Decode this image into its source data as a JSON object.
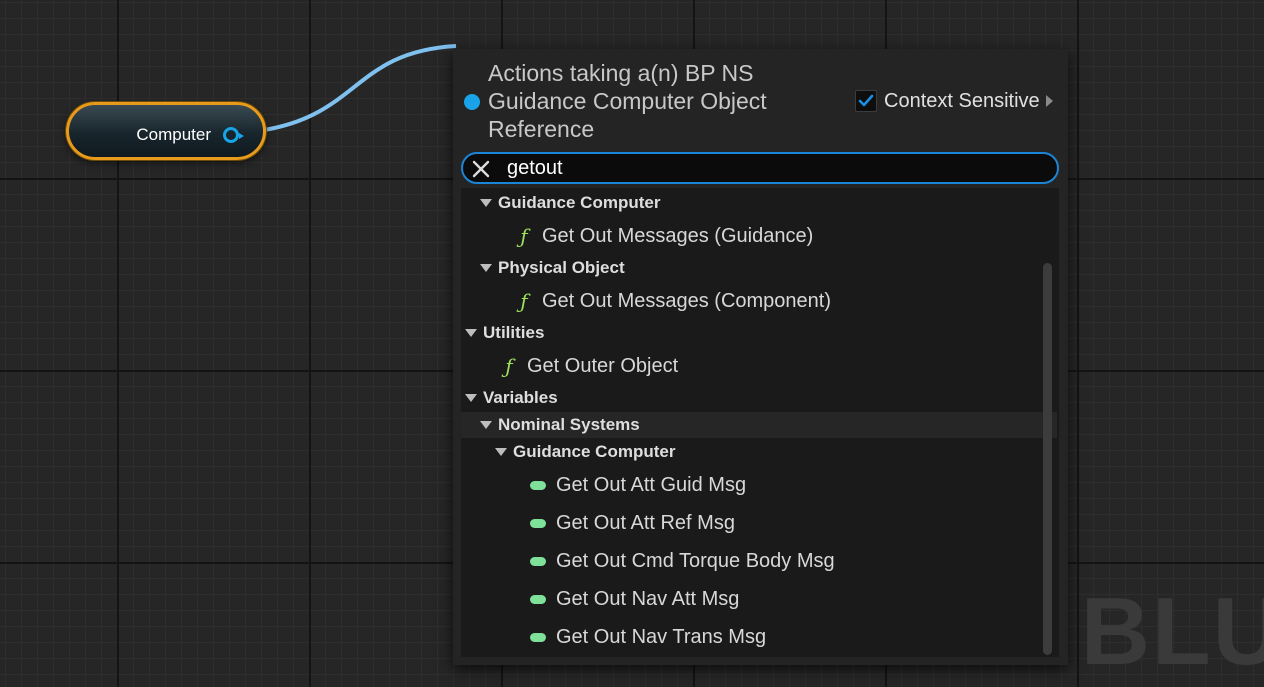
{
  "node": {
    "label": "Computer",
    "pin_color": "#18a4e6",
    "border_color": "#e89a1a"
  },
  "menu": {
    "title": "Actions taking a(n) BP NS Guidance Computer Object Reference",
    "context_sensitive": {
      "label": "Context Sensitive",
      "checked": true
    },
    "search": {
      "value": "getout",
      "clear_icon": "close-icon"
    },
    "accent_color": "#1a86d6"
  },
  "tree": [
    {
      "type": "category",
      "label": "Guidance Computer",
      "depth": 1
    },
    {
      "type": "function",
      "label": "Get Out Messages (Guidance)",
      "depth": 2,
      "icon": "function-icon"
    },
    {
      "type": "category",
      "label": "Physical Object",
      "depth": 1
    },
    {
      "type": "function",
      "label": "Get Out Messages (Component)",
      "depth": 2,
      "icon": "function-icon"
    },
    {
      "type": "category",
      "label": "Utilities",
      "depth": 0
    },
    {
      "type": "function",
      "label": "Get Outer Object",
      "depth": 1,
      "icon": "function-icon"
    },
    {
      "type": "category",
      "label": "Variables",
      "depth": 0
    },
    {
      "type": "category",
      "label": "Nominal Systems",
      "depth": 1,
      "highlighted": true
    },
    {
      "type": "category",
      "label": "Guidance Computer",
      "depth": 2
    },
    {
      "type": "variable",
      "label": "Get Out Att Guid Msg",
      "depth": 3,
      "icon": "variable-pill-icon"
    },
    {
      "type": "variable",
      "label": "Get Out Att Ref Msg",
      "depth": 3,
      "icon": "variable-pill-icon"
    },
    {
      "type": "variable",
      "label": "Get Out Cmd Torque Body Msg",
      "depth": 3,
      "icon": "variable-pill-icon"
    },
    {
      "type": "variable",
      "label": "Get Out Nav Att Msg",
      "depth": 3,
      "icon": "variable-pill-icon"
    },
    {
      "type": "variable",
      "label": "Get Out Nav Trans Msg",
      "depth": 3,
      "icon": "variable-pill-icon"
    }
  ],
  "watermark": "L BLU"
}
